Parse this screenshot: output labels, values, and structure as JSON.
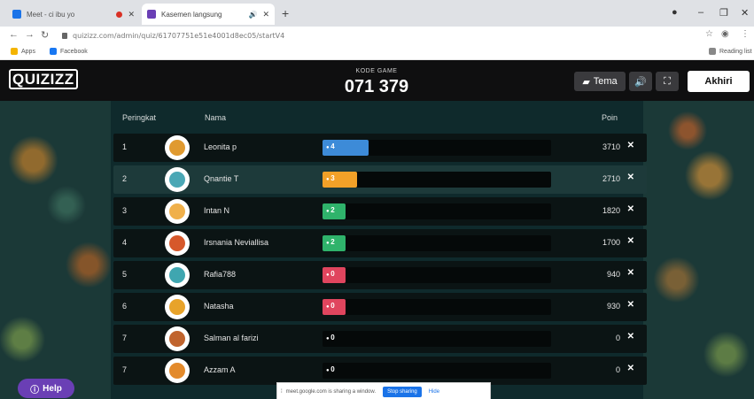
{
  "browser": {
    "tabs": [
      {
        "title": "Meet - ci ibu yo",
        "favicon_color": "#1a73e8",
        "recording": true
      },
      {
        "title": "Kasemen langsung",
        "favicon_color": "#6a3fb5",
        "audio": true
      }
    ],
    "url": "quizizz.com/admin/quiz/61707751e51e4001d8ec05/startV4",
    "bookmarks": [
      {
        "label": "Apps",
        "color": "#f4b400"
      },
      {
        "label": "Facebook",
        "color": "#1877f2"
      }
    ],
    "reading_list": "Reading list"
  },
  "header": {
    "logo": "QUIZIZZ",
    "code_label": "KODE GAME",
    "code_value": "071 379",
    "tema_label": "Tema",
    "end_label": "Akhiri"
  },
  "table": {
    "col_rank": "Peringkat",
    "col_name": "Nama",
    "col_points": "Poin",
    "rows": [
      {
        "rank": "1",
        "name": "Leonita p",
        "correct": "4",
        "points": "3710",
        "fill_fraction": 0.2,
        "color": "#3d8bd8",
        "avatar": "#e09a30",
        "highlight": false
      },
      {
        "rank": "2",
        "name": "Qnantie T",
        "correct": "3",
        "points": "2710",
        "fill_fraction": 0.15,
        "color": "#f2a128",
        "avatar": "#4aa7b5",
        "highlight": true
      },
      {
        "rank": "3",
        "name": "Intan N",
        "correct": "2",
        "points": "1820",
        "fill_fraction": 0.1,
        "color": "#2fb36b",
        "avatar": "#f0b04a",
        "highlight": false
      },
      {
        "rank": "4",
        "name": "Irsnania Neviallisa",
        "correct": "2",
        "points": "1700",
        "fill_fraction": 0.1,
        "color": "#2fb36b",
        "avatar": "#d6582b",
        "highlight": false
      },
      {
        "rank": "5",
        "name": "Rafia788",
        "correct": "0",
        "points": "940",
        "fill_fraction": 0.1,
        "color": "#e0455e",
        "avatar": "#3fa6b0",
        "highlight": false
      },
      {
        "rank": "6",
        "name": "Natasha",
        "correct": "0",
        "points": "930",
        "fill_fraction": 0.1,
        "color": "#e0455e",
        "avatar": "#e8a32a",
        "highlight": false
      },
      {
        "rank": "7",
        "name": "Salman al farizi",
        "correct": "0",
        "points": "0",
        "fill_fraction": 0,
        "color": "#050909",
        "avatar": "#c0642e",
        "highlight": false
      },
      {
        "rank": "7",
        "name": "Azzam A",
        "correct": "0",
        "points": "0",
        "fill_fraction": 0,
        "color": "#050909",
        "avatar": "#e38a2b",
        "highlight": false
      }
    ]
  },
  "help_label": "Help",
  "share": {
    "message": "meet.google.com is sharing a window.",
    "stop_label": "Stop sharing",
    "hide_label": "Hide"
  }
}
